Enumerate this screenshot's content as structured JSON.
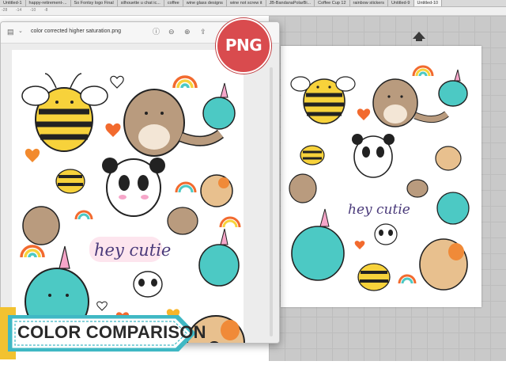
{
  "browser": {
    "tabs": [
      {
        "label": "Untitled-1"
      },
      {
        "label": "happy-retirement-..."
      },
      {
        "label": "So Fontsy logo Final"
      },
      {
        "label": "silhouette u chat ic..."
      },
      {
        "label": "coffee"
      },
      {
        "label": "wine glass designs"
      },
      {
        "label": "wine not screw it"
      },
      {
        "label": "JB-BandanaPolarBi..."
      },
      {
        "label": "Coffee Cup 12"
      },
      {
        "label": "rainbow stickers"
      },
      {
        "label": "Untitled-9"
      },
      {
        "label": "Untitled-10"
      }
    ]
  },
  "ruler": {
    "marks": [
      "-28",
      "-14",
      "-10",
      "-8"
    ]
  },
  "preview": {
    "title": "color corrected higher saturation.png",
    "toolbar_icons": [
      "sidebar-icon",
      "info-icon",
      "zoom-out-icon",
      "zoom-in-icon",
      "share-icon",
      "markup-icon"
    ]
  },
  "stickers": {
    "left_text": "hey cutie",
    "right_text": "hey cutie"
  },
  "badge": {
    "label": "PNG"
  },
  "banner": {
    "label": "COLOR COMPARISON"
  },
  "colors": {
    "badge": "#d94b4e",
    "banner_teal": "#3fb8c4",
    "banner_yellow": "#f2c230",
    "bee": "#f7d23b",
    "narwhal": "#4cc9c4",
    "cat": "#b99b7e",
    "dog": "#e8c08e",
    "heart": "#f26a2e"
  }
}
